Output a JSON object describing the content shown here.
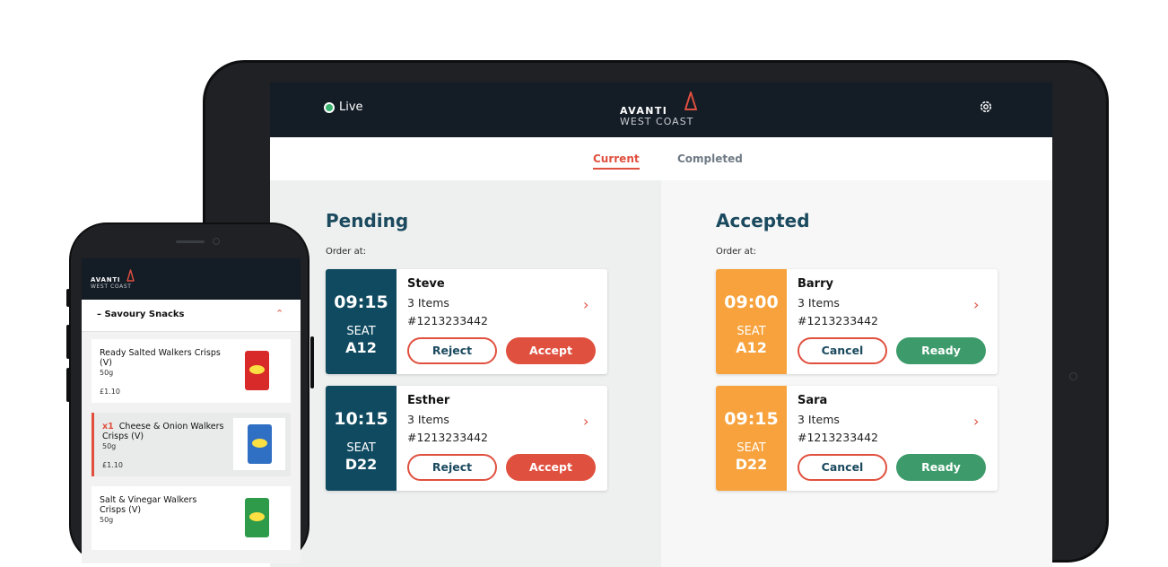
{
  "tablet": {
    "status": "Live",
    "brand_top": "AVANTI",
    "brand_bottom": "WEST COAST",
    "tabs": [
      {
        "label": "Current",
        "active": true
      },
      {
        "label": "Completed",
        "active": false
      }
    ],
    "pending": {
      "title": "Pending",
      "order_at": "Order at:",
      "orders": [
        {
          "time": "09:15",
          "seat_label": "SEAT",
          "seat": "A12",
          "name": "Steve",
          "items": "3 Items",
          "ref": "#1213233442",
          "btn1": "Reject",
          "btn2": "Accept"
        },
        {
          "time": "10:15",
          "seat_label": "SEAT",
          "seat": "D22",
          "name": "Esther",
          "items": "3 Items",
          "ref": "#1213233442",
          "btn1": "Reject",
          "btn2": "Accept"
        }
      ]
    },
    "accepted": {
      "title": "Accepted",
      "order_at": "Order at:",
      "orders": [
        {
          "time": "09:00",
          "seat_label": "SEAT",
          "seat": "A12",
          "name": "Barry",
          "items": "3 Items",
          "ref": "#1213233442",
          "btn1": "Cancel",
          "btn2": "Ready"
        },
        {
          "time": "09:15",
          "seat_label": "SEAT",
          "seat": "D22",
          "name": "Sara",
          "items": "3 Items",
          "ref": "#1213233442",
          "btn1": "Cancel",
          "btn2": "Ready"
        }
      ]
    }
  },
  "phone": {
    "brand_top": "AVANTI",
    "brand_bottom": "WEST COAST",
    "section_title": "– Savoury Snacks",
    "items": [
      {
        "qty": "",
        "name": "Ready Salted Walkers Crisps (V)",
        "weight": "50g",
        "price": "£1.10",
        "selected": false
      },
      {
        "qty": "x1",
        "name": "Cheese & Onion Walkers Crisps (V)",
        "weight": "50g",
        "price": "£1.10",
        "selected": true
      },
      {
        "qty": "",
        "name": "Salt & Vinegar Walkers Crisps (V)",
        "weight": "50g",
        "price": "",
        "selected": false
      }
    ]
  },
  "colors": {
    "accent": "#e0503f",
    "navy": "#141c26",
    "pending": "#0f4a60",
    "accepted": "#f7a23c",
    "ready": "#3d9b6b",
    "live": "#3cb371"
  },
  "icons": {
    "status": "live-dot-icon",
    "settings": "gear-icon",
    "logo": "avanti-sail-icon",
    "order_open": "chevron-right-icon",
    "collapse": "chevron-up-icon"
  }
}
